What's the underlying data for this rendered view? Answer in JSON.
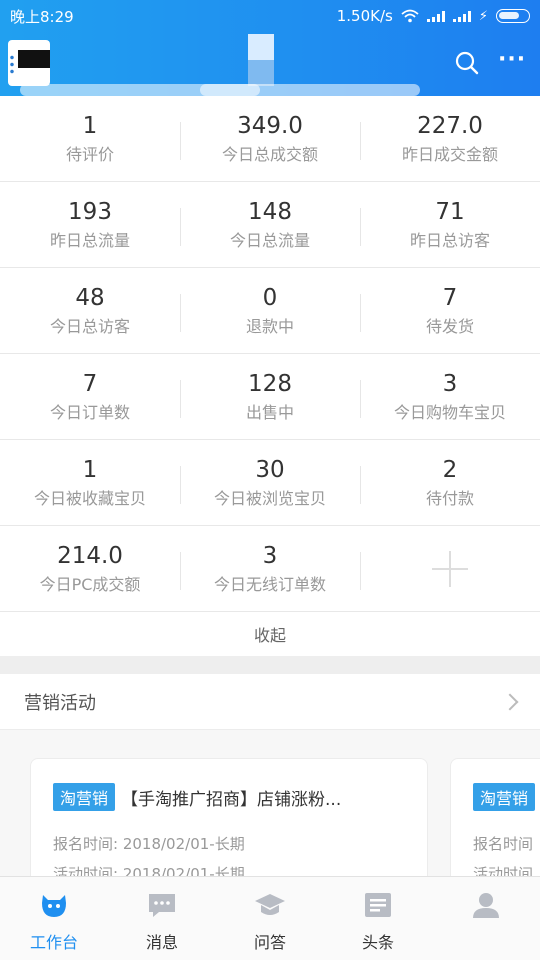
{
  "status_bar": {
    "time": "晚上8:29",
    "net_speed": "1.50K/s"
  },
  "header": {
    "search_icon": "search-icon",
    "more_icon": "more-icon"
  },
  "stats": [
    [
      {
        "value": "1",
        "label": "待评价"
      },
      {
        "value": "349.0",
        "label": "今日总成交额"
      },
      {
        "value": "227.0",
        "label": "昨日成交金额"
      }
    ],
    [
      {
        "value": "193",
        "label": "昨日总流量"
      },
      {
        "value": "148",
        "label": "今日总流量"
      },
      {
        "value": "71",
        "label": "昨日总访客"
      }
    ],
    [
      {
        "value": "48",
        "label": "今日总访客"
      },
      {
        "value": "0",
        "label": "退款中"
      },
      {
        "value": "7",
        "label": "待发货"
      }
    ],
    [
      {
        "value": "7",
        "label": "今日订单数"
      },
      {
        "value": "128",
        "label": "出售中"
      },
      {
        "value": "3",
        "label": "今日购物车宝贝"
      }
    ],
    [
      {
        "value": "1",
        "label": "今日被收藏宝贝"
      },
      {
        "value": "30",
        "label": "今日被浏览宝贝"
      },
      {
        "value": "2",
        "label": "待付款"
      }
    ],
    [
      {
        "value": "214.0",
        "label": "今日PC成交额"
      },
      {
        "value": "3",
        "label": "今日无线订单数"
      }
    ]
  ],
  "collapse_label": "收起",
  "marketing": {
    "title": "营销活动",
    "cards": [
      {
        "tag": "淘营销",
        "title": "【手淘推广招商】店铺涨粉...",
        "signup": "报名时间: 2018/02/01-长期",
        "activity": "活动时间: 2018/02/01-长期"
      },
      {
        "tag": "淘营销",
        "signup": "报名时间",
        "activity": "活动时间"
      }
    ]
  },
  "tabs": [
    {
      "label": "工作台",
      "icon": "workbench-icon",
      "active": true
    },
    {
      "label": "消息",
      "icon": "message-icon"
    },
    {
      "label": "问答",
      "icon": "qa-icon"
    },
    {
      "label": "头条",
      "icon": "headlines-icon"
    },
    {
      "label": "",
      "icon": "profile-icon"
    }
  ],
  "colors": {
    "accent": "#1f8ff0",
    "tag": "#34a0e8",
    "label_gray": "#999999"
  }
}
